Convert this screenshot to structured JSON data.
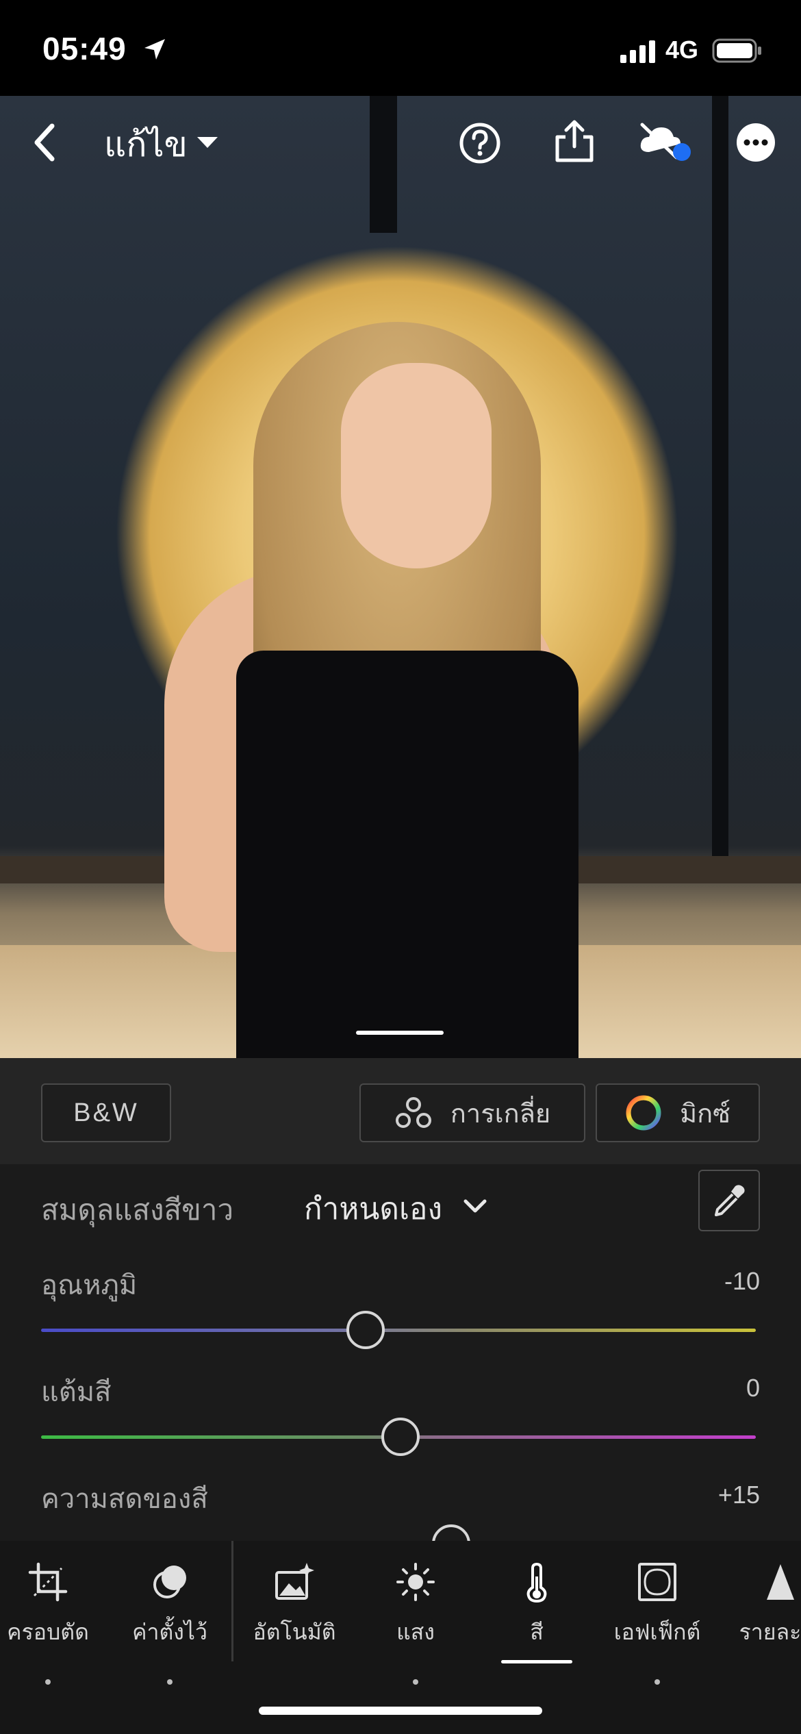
{
  "status_bar": {
    "time": "05:49",
    "network": "4G"
  },
  "header": {
    "title": "แก้ไข"
  },
  "color_modes": {
    "bw": "B&W",
    "grading": "การเกลี่ย",
    "mix": "มิกซ์"
  },
  "white_balance": {
    "label": "สมดุลแสงสีขาว",
    "value": "กำหนดเอง"
  },
  "sliders": [
    {
      "label": "อุณหภูมิ",
      "value": "-10"
    },
    {
      "label": "แต้มสี",
      "value": "0"
    },
    {
      "label": "ความสดของสี",
      "value": "+15"
    }
  ],
  "toolbar": {
    "items": [
      {
        "label": "ครอบตัด",
        "icon": "crop-icon"
      },
      {
        "label": "ค่าตั้งไว้",
        "icon": "presets-icon"
      },
      {
        "label": "อัตโนมัติ",
        "icon": "auto-icon"
      },
      {
        "label": "แสง",
        "icon": "light-icon"
      },
      {
        "label": "สี",
        "icon": "thermometer-icon"
      },
      {
        "label": "เอฟเฟ็กต์",
        "icon": "effects-icon"
      },
      {
        "label": "รายละเอี",
        "icon": "detail-icon"
      }
    ],
    "active": "สี"
  },
  "colors": {
    "accent_blue": "#1e6ef4",
    "panel_bg": "#1b1b1b"
  }
}
